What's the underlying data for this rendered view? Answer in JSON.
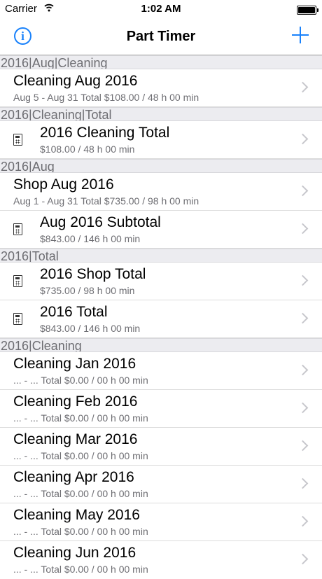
{
  "status": {
    "carrier": "Carrier",
    "time": "1:02 AM"
  },
  "nav": {
    "title": "Part Timer",
    "info_glyph": "i"
  },
  "sections": [
    {
      "header": "2016|Aug|Cleaning",
      "rows": [
        {
          "title": "Cleaning Aug 2016",
          "subtitle": "Aug 5 - Aug 31 Total $108.00 / 48 h 00 min"
        }
      ]
    },
    {
      "header": "2016|Cleaning|Total",
      "rows": [
        {
          "title": "2016 Cleaning Total",
          "subtitle": "$108.00 / 48 h 00 min"
        }
      ]
    },
    {
      "header": "2016|Aug",
      "rows": [
        {
          "title": "Shop Aug 2016",
          "subtitle": "Aug 1 - Aug 31 Total $735.00 / 98 h 00 min"
        },
        {
          "title": "Aug 2016 Subtotal",
          "subtitle": "$843.00 / 146 h 00 min"
        }
      ]
    },
    {
      "header": "2016|Total",
      "rows": [
        {
          "title": "2016 Shop Total",
          "subtitle": "$735.00 / 98 h 00 min"
        },
        {
          "title": "2016 Total",
          "subtitle": "$843.00 / 146 h 00 min"
        }
      ]
    },
    {
      "header": "2016|Cleaning",
      "rows": [
        {
          "title": "Cleaning Jan 2016",
          "subtitle": "... - ... Total $0.00 / 00 h 00 min"
        },
        {
          "title": "Cleaning Feb 2016",
          "subtitle": "... - ... Total $0.00 / 00 h 00 min"
        },
        {
          "title": "Cleaning Mar 2016",
          "subtitle": "... - ... Total $0.00 / 00 h 00 min"
        },
        {
          "title": "Cleaning Apr 2016",
          "subtitle": "... - ... Total $0.00 / 00 h 00 min"
        },
        {
          "title": "Cleaning May 2016",
          "subtitle": "... - ... Total $0.00 / 00 h 00 min"
        },
        {
          "title": "Cleaning Jun 2016",
          "subtitle": "... - ... Total $0.00 / 00 h 00 min"
        }
      ]
    }
  ],
  "icons": {
    "info": "info-circle-icon",
    "add": "plus-icon",
    "calculator": "calculator-icon",
    "disclosure": "chevron-right-icon",
    "wifi": "wifi-icon",
    "battery": "battery-icon"
  },
  "colors": {
    "accent": "#1a82fb",
    "section_bg": "#ececf0",
    "secondary_text": "#6d6d72"
  }
}
